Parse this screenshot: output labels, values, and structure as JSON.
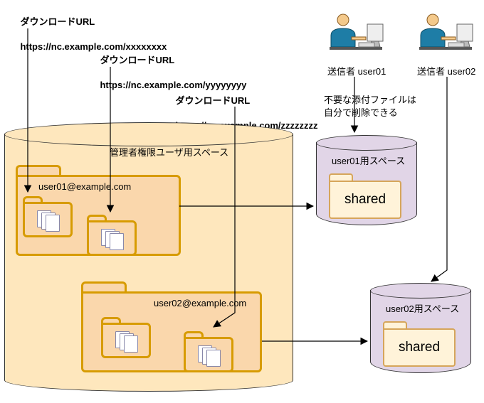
{
  "urls": {
    "u1": {
      "title": "ダウンロードURL",
      "url": "https://nc.example.com/xxxxxxxx"
    },
    "u2": {
      "title": "ダウンロードURL",
      "url": "https://nc.example.com/yyyyyyyy"
    },
    "u3": {
      "title": "ダウンロードURL",
      "url": "https://nc.example.com/zzzzzzzz"
    }
  },
  "senders": {
    "s1": "送信者 user01",
    "s2": "送信者 user02"
  },
  "note": "不要な添付ファイルは\n自分で削除できる",
  "spaces": {
    "admin": "管理者権限ユーザ用スペース",
    "u1": "user01用スペース",
    "u2": "user02用スペース"
  },
  "folders": {
    "f1": "user01@example.com",
    "f2": "user02@example.com",
    "shared": "shared"
  },
  "icons": {
    "user": "user-at-desk-icon",
    "folder": "file-folder-icon",
    "shared_folder": "shared-folder-icon",
    "cylinder": "storage-cylinder-icon"
  },
  "colors": {
    "yellow_fill": "#fee7bd",
    "purple_fill": "#e1d5e7",
    "folder_fill": "#fad7ac",
    "folder_stroke": "#d79b00",
    "ink": "#000000"
  }
}
